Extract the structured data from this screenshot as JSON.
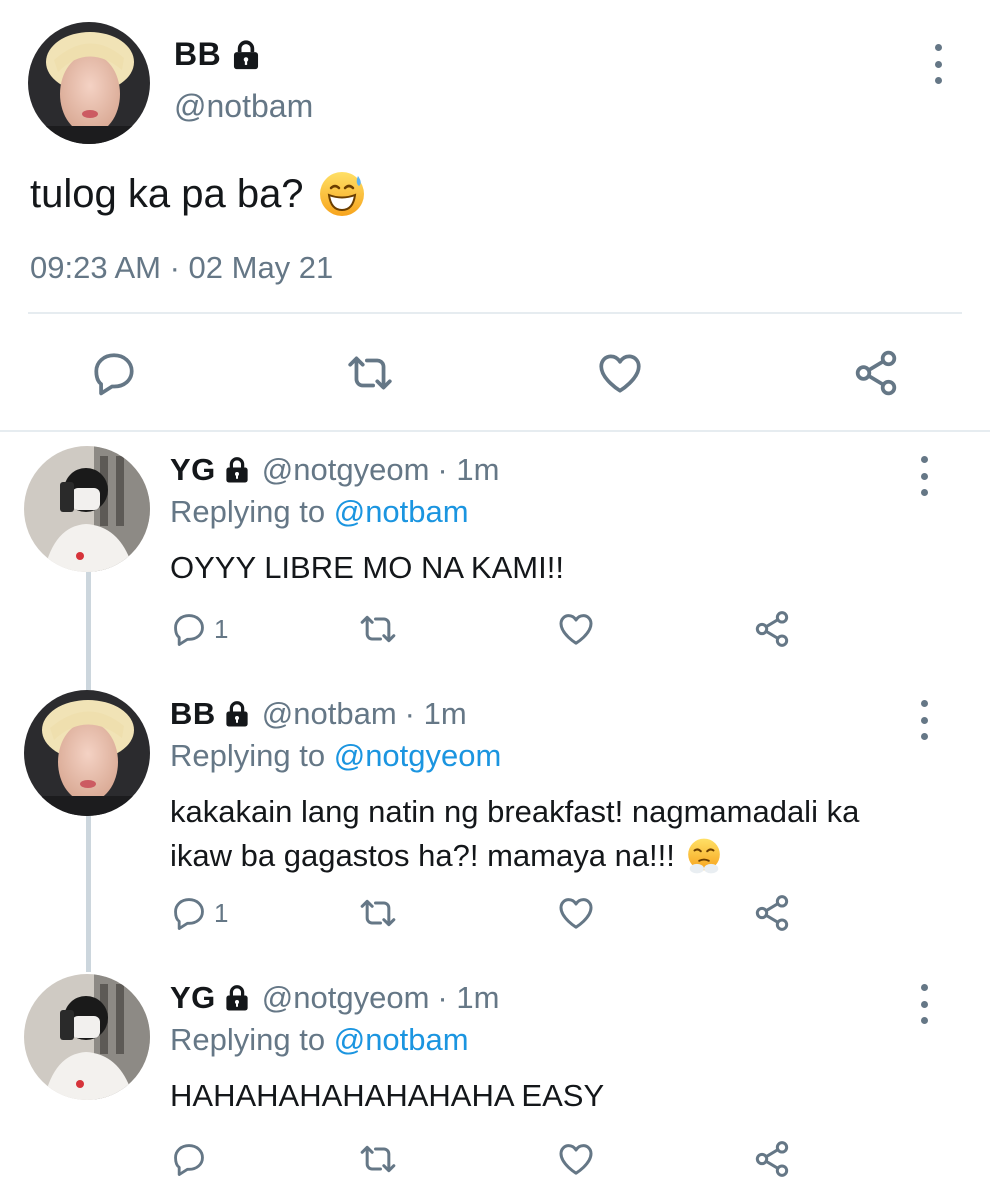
{
  "main_tweet": {
    "name": "BB",
    "handle": "@notbam",
    "text": "tulog ka pa ba?",
    "emoji": "grinning-face-with-sweat",
    "timestamp": "09:23 AM · 02 May 21"
  },
  "replies": [
    {
      "name": "YG",
      "handle": "@notgyeom",
      "time": "· 1m",
      "replying_label": "Replying to",
      "replying_to": "@notbam",
      "text": "OYYY LIBRE MO NA KAMI!!",
      "reply_count": "1"
    },
    {
      "name": "BB",
      "handle": "@notbam",
      "time": "· 1m",
      "replying_label": "Replying to",
      "replying_to": "@notgyeom",
      "text_line1": "kakakain lang natin ng breakfast! nagmamadali ka",
      "text_line2": "ikaw ba gagastos ha?! mamaya na!!!",
      "emoji": "face-with-steam-from-nose",
      "reply_count": "1"
    },
    {
      "name": "YG",
      "handle": "@notgyeom",
      "time": "· 1m",
      "replying_label": "Replying to",
      "replying_to": "@notbam",
      "text": "HAHAHAHAHAHAHAHA EASY",
      "reply_count": ""
    }
  ],
  "colors": {
    "text": "#14171a",
    "secondary": "#657786",
    "link": "#1b95e0",
    "divider": "#e6ecf0",
    "thread_line": "#ccd6dd"
  },
  "icons": [
    "lock-icon",
    "more-vertical-icon",
    "reply-icon",
    "retweet-icon",
    "like-icon",
    "share-icon"
  ]
}
